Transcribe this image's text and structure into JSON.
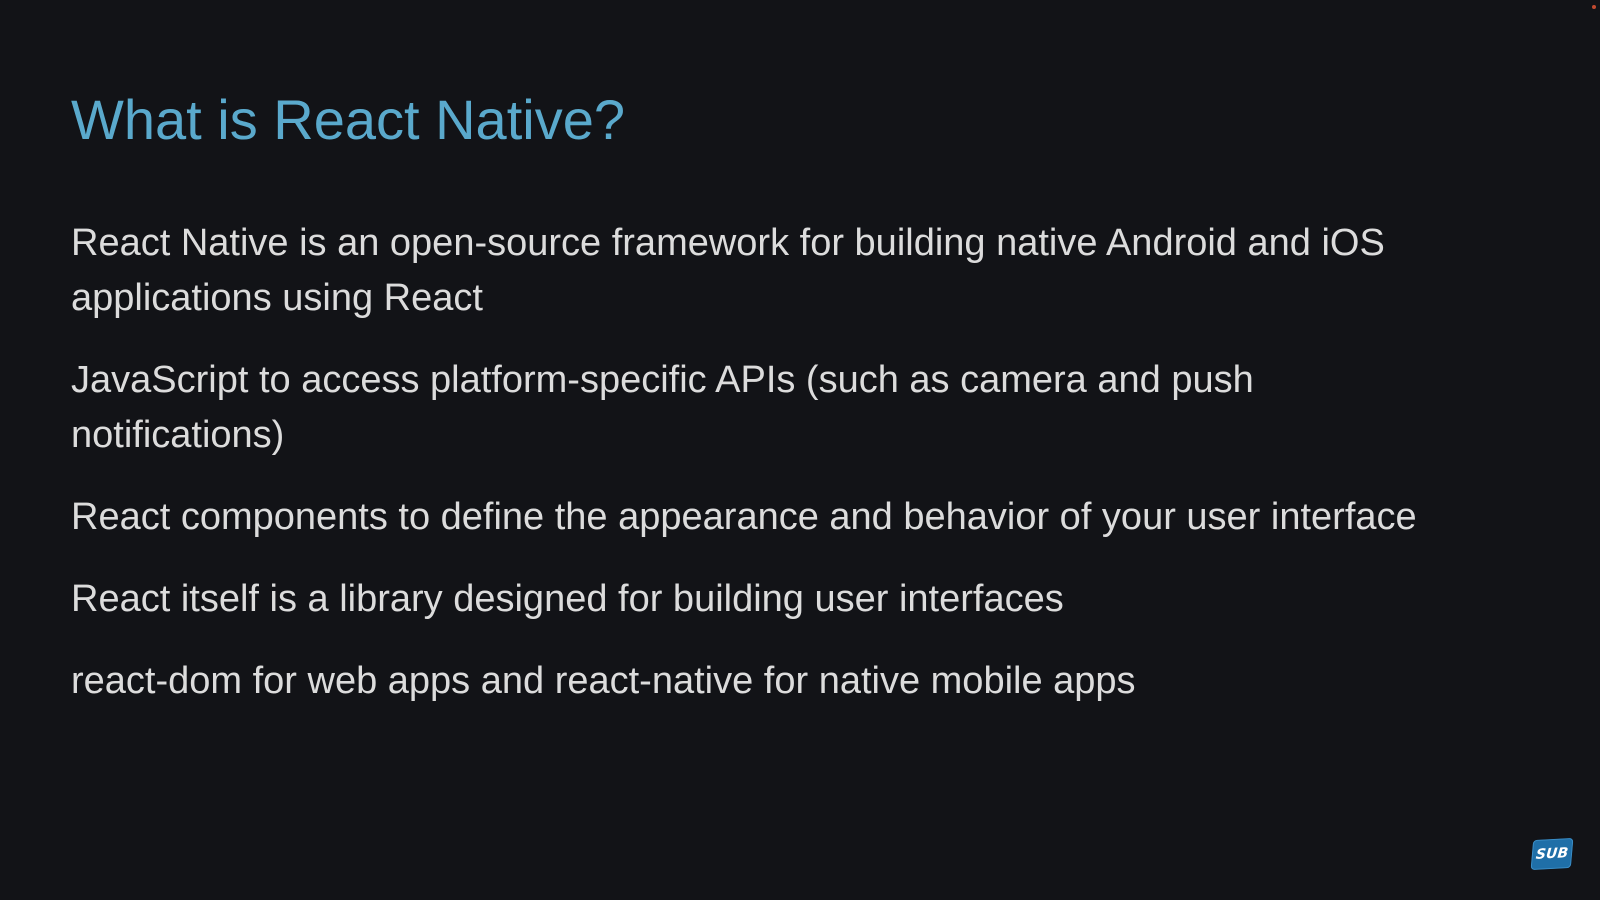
{
  "slide": {
    "title": "What is React Native?",
    "bullets": [
      "React Native is an open-source framework for building native Android and iOS applications using React",
      "JavaScript to access platform-specific APIs (such as camera and push notifications)",
      "React components to define the appearance and behavior of your user interface",
      "React itself is a library designed for building user interfaces",
      "react-dom for web apps and react-native for native mobile apps"
    ]
  },
  "badge": {
    "label": "SUB"
  },
  "colors": {
    "background": "#121317",
    "title": "#5aa9cc",
    "text": "#dcdcdc",
    "badge": "#1f6fa8"
  }
}
